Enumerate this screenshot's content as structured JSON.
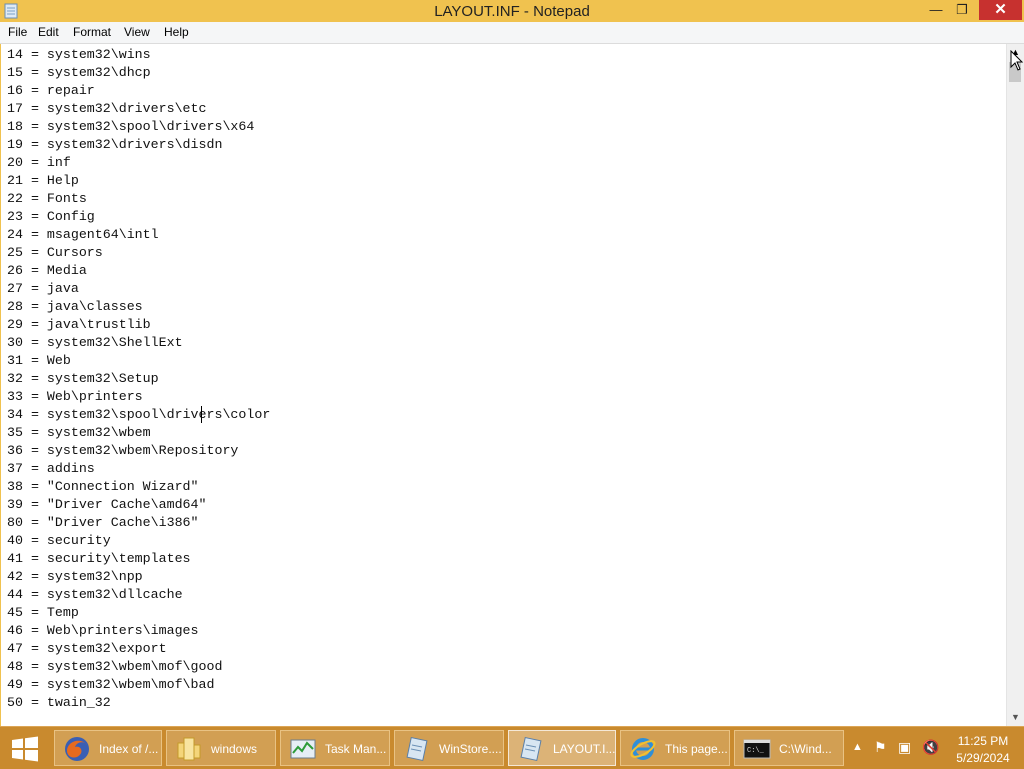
{
  "window": {
    "title": "LAYOUT.INF - Notepad",
    "minimize_glyph": "—",
    "maximize_glyph": "❐",
    "close_glyph": "✕"
  },
  "menu": [
    "File",
    "Edit",
    "Format",
    "View",
    "Help"
  ],
  "editor": {
    "lines": [
      "14 = system32\\wins",
      "15 = system32\\dhcp",
      "16 = repair",
      "17 = system32\\drivers\\etc",
      "18 = system32\\spool\\drivers\\x64",
      "19 = system32\\drivers\\disdn",
      "20 = inf",
      "21 = Help",
      "22 = Fonts",
      "23 = Config",
      "24 = msagent64\\intl",
      "25 = Cursors",
      "26 = Media",
      "27 = java",
      "28 = java\\classes",
      "29 = java\\trustlib",
      "30 = system32\\ShellExt",
      "31 = Web",
      "32 = system32\\Setup",
      "33 = Web\\printers",
      "34 = system32\\spool\\drivers\\color",
      "35 = system32\\wbem",
      "36 = system32\\wbem\\Repository",
      "37 = addins",
      "38 = \"Connection Wizard\"",
      "39 = \"Driver Cache\\amd64\"",
      "80 = \"Driver Cache\\i386\"",
      "40 = security",
      "41 = security\\templates",
      "42 = system32\\npp",
      "44 = system32\\dllcache",
      "45 = Temp",
      "46 = Web\\printers\\images",
      "47 = system32\\export",
      "48 = system32\\wbem\\mof\\good",
      "49 = system32\\wbem\\mof\\bad",
      "50 = twain_32"
    ]
  },
  "taskbar": {
    "items": [
      {
        "label": "Index of /...",
        "icon": "firefox-icon"
      },
      {
        "label": "windows",
        "icon": "folder-icon"
      },
      {
        "label": "Task Man...",
        "icon": "task-manager-icon"
      },
      {
        "label": "WinStore....",
        "icon": "notepad-icon"
      },
      {
        "label": "LAYOUT.I...",
        "icon": "notepad-icon"
      },
      {
        "label": "This page...",
        "icon": "internet-explorer-icon"
      },
      {
        "label": "C:\\Wind...",
        "icon": "command-prompt-icon"
      }
    ],
    "clock": {
      "time": "11:25 PM",
      "date": "5/29/2024"
    }
  },
  "colors": {
    "titlebar": "#f0c24f",
    "close_button": "#c7312f",
    "taskbar": "#c98a2e"
  }
}
